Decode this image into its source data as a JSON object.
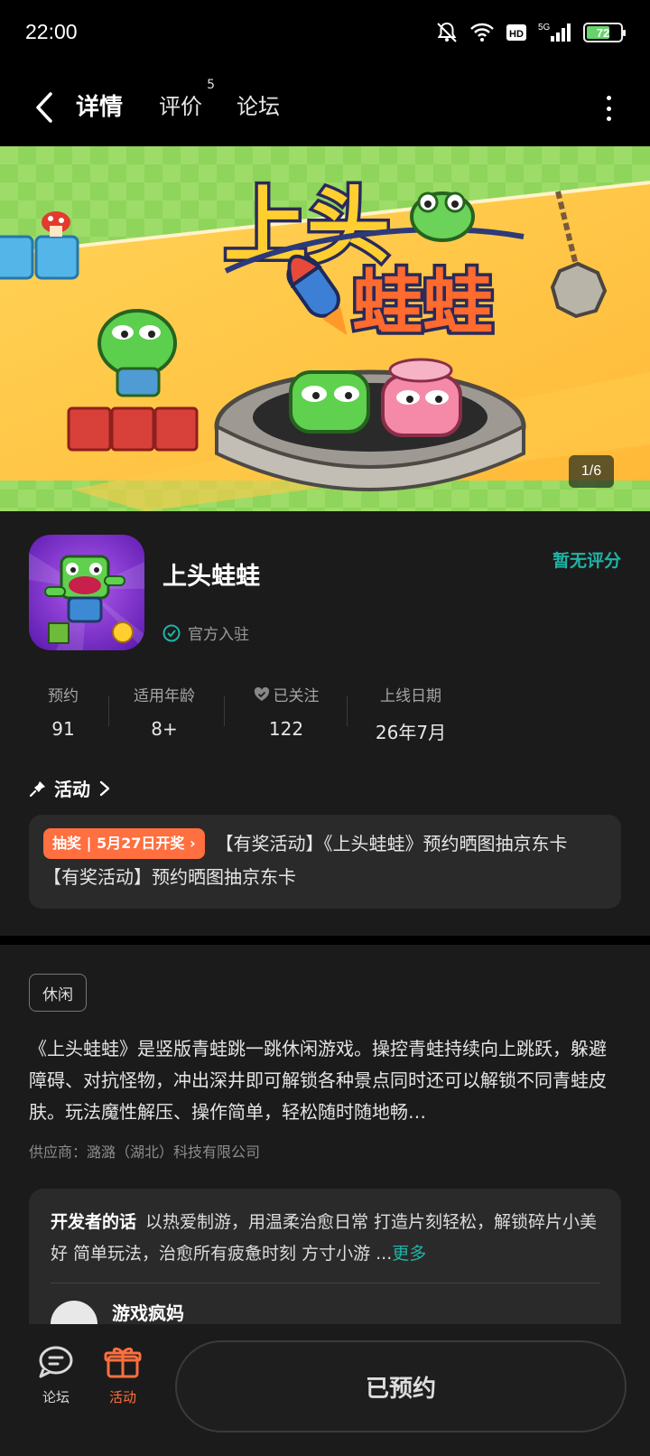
{
  "status_bar": {
    "time": "22:00",
    "network": "5G",
    "hd": "HD",
    "battery": "72",
    "battery_level": 0.72
  },
  "nav": {
    "tabs": [
      {
        "label": "详情",
        "active": true
      },
      {
        "label": "评价",
        "badge": "5"
      },
      {
        "label": "论坛"
      }
    ]
  },
  "banner": {
    "logo_line1": "上头",
    "logo_line2": "蛙蛙",
    "counter": "1/6"
  },
  "app": {
    "name": "上头蛙蛙",
    "official": "官方入驻",
    "rating": "暂无评分"
  },
  "stats": [
    {
      "label": "预约",
      "value": "91"
    },
    {
      "label": "适用年龄",
      "value": "8+"
    },
    {
      "label": "已关注",
      "value": "122"
    },
    {
      "label": "上线日期",
      "value": "26年7月"
    }
  ],
  "activity": {
    "heading": "活动",
    "pill": "抽奖 | 5月27日开奖 ›",
    "text": "【有奖活动】《上头蛙蛙》预约晒图抽京东卡 【有奖活动】预约晒图抽京东卡"
  },
  "tag": "休闲",
  "description": "《上头蛙蛙》是竖版青蛙跳一跳休闲游戏。操控青蛙持续向上跳跃，躲避障碍、对抗怪物，冲出深井即可解锁各种景点同时还可以解锁不同青蛙皮肤。玩法魔性解压、操作简单，轻松随时随地畅…",
  "supplier": "供应商：潞潞（湖北）科技有限公司",
  "developer": {
    "title": "开发者的话",
    "text": "以热爱制游，用温柔治愈日常 打造片刻轻松，解锁碎片小美好 简单玩法，治愈所有疲惫时刻 方寸小游 ...",
    "more": "更多",
    "avatar_text": "",
    "username": "游戏疯妈"
  },
  "bottom": {
    "forum": "论坛",
    "activity": "活动",
    "reserve": "已预约"
  },
  "colors": {
    "accent": "#1fb3a6",
    "orange": "#ff6f3f"
  }
}
